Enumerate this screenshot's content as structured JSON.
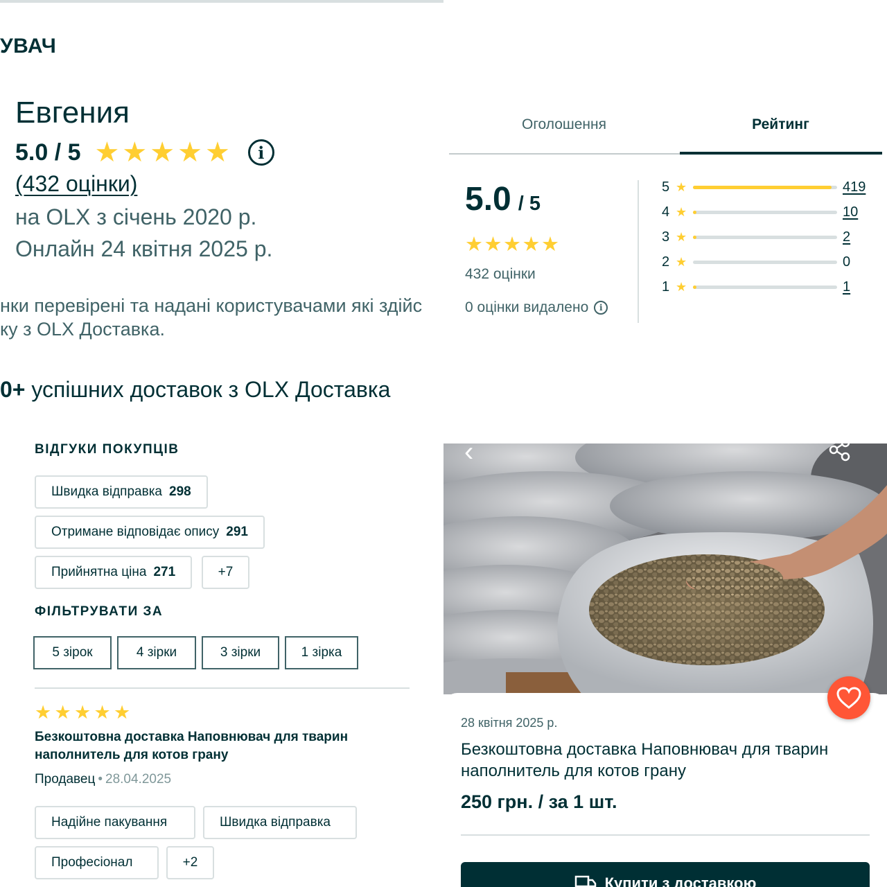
{
  "seller": {
    "section_title": "УВАЧ",
    "name": "Евгения",
    "score": "5.0 / 5",
    "stars": 5,
    "reviews_link": "(432 оцінки)",
    "member_since": "на OLX з січень 2020 р.",
    "online": "Онлайн 24 квітня 2025 р.",
    "verified_note_line1": "нки перевірені та надані користувачами які здійс",
    "verified_note_line2": "ку з OLX Доставка.",
    "deliveries_prefix": "0+",
    "deliveries_text": " успішних доставок з OLX Доставка"
  },
  "rating_panel": {
    "tabs": [
      {
        "label": "Оголошення",
        "active": false
      },
      {
        "label": "Рейтинг",
        "active": true
      }
    ],
    "score_value": "5.0",
    "score_max": "/ 5",
    "stars": 5,
    "ratings_count": "432 оцінки",
    "removed_text": "0 оцінки видалено",
    "breakdown": [
      {
        "stars": "5",
        "count": "419",
        "share": 0.96
      },
      {
        "stars": "4",
        "count": "10",
        "share": 0.024
      },
      {
        "stars": "3",
        "count": "2",
        "share": 0.005
      },
      {
        "stars": "2",
        "count": "0",
        "share": 0
      },
      {
        "stars": "1",
        "count": "1",
        "share": 0.002
      }
    ]
  },
  "feedback": {
    "title": "ВІДГУКИ ПОКУПЦІВ",
    "tags": [
      {
        "label": "Швидка відправка",
        "count": "298"
      },
      {
        "label": "Отримане відповідає опису",
        "count": "291"
      },
      {
        "label": "Прийнятна ціна",
        "count": "271"
      }
    ],
    "more": "+7",
    "filter_title": "ФІЛЬТРУВАТИ ЗА",
    "filters": [
      "5 зірок",
      "4 зірки",
      "3 зірки",
      "1 зірка"
    ]
  },
  "review": {
    "stars": 5,
    "title": "Безкоштовна доставка Наповнювач для тварин наполнитель для котов грану",
    "author": "Продавец",
    "date": "28.04.2025",
    "tags": [
      "Надійне пакування",
      "Швидка відправка",
      "Професіонал"
    ],
    "more": "+2"
  },
  "product": {
    "date": "28 квітня 2025 р.",
    "title": "Безкоштовна доставка Наповнювач для тварин наполнитель для котов грану",
    "price": "250 грн. / за 1 шт.",
    "buy_label": "Купити з доставкою"
  },
  "colors": {
    "text": "#002f34",
    "muted": "#406367",
    "star": "#ffce32",
    "favorite": "#ff5636",
    "border": "#d8dfe0"
  },
  "icons": [
    "info-icon",
    "star-icon",
    "back-arrow-icon",
    "share-icon",
    "heart-icon",
    "truck-icon"
  ]
}
